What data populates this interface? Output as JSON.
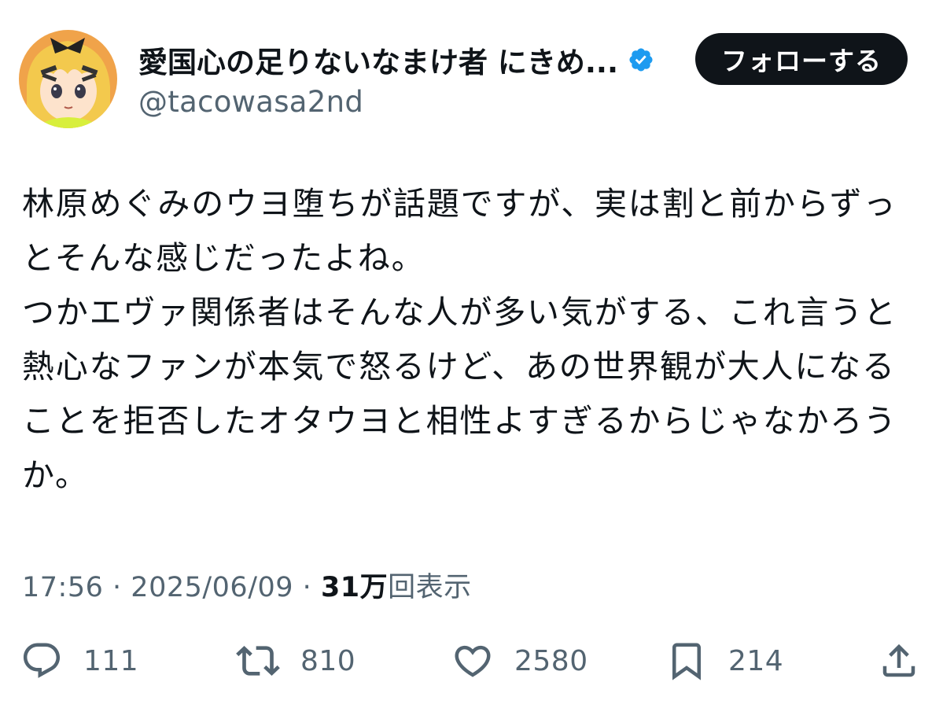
{
  "user": {
    "display_name": "愛国心の足りないなまけ者 にきめ...",
    "handle": "@tacowasa2nd",
    "verified": true,
    "verified_color": "#1d9bf0"
  },
  "header": {
    "follow_label": "フォローする"
  },
  "tweet": {
    "text": "林原めぐみのウヨ堕ちが話題ですが、実は割と前からずっとそんな感じだったよね。\nつかエヴァ関係者はそんな人が多い気がする、これ言うと熱心なファンが本気で怒るけど、あの世界観が大人になることを拒否したオタウヨと相性よすぎるからじゃなかろうか。"
  },
  "meta": {
    "time": "17:56",
    "separator1": "·",
    "date": "2025/06/09",
    "separator2": "·",
    "views_count": "31万",
    "views_label": "回表示"
  },
  "actions": {
    "replies": "111",
    "retweets": "810",
    "likes": "2580",
    "bookmarks": "214"
  },
  "icons": {
    "reply": "reply-icon",
    "retweet": "retweet-icon",
    "like": "heart-icon",
    "bookmark": "bookmark-icon",
    "share": "share-icon"
  }
}
